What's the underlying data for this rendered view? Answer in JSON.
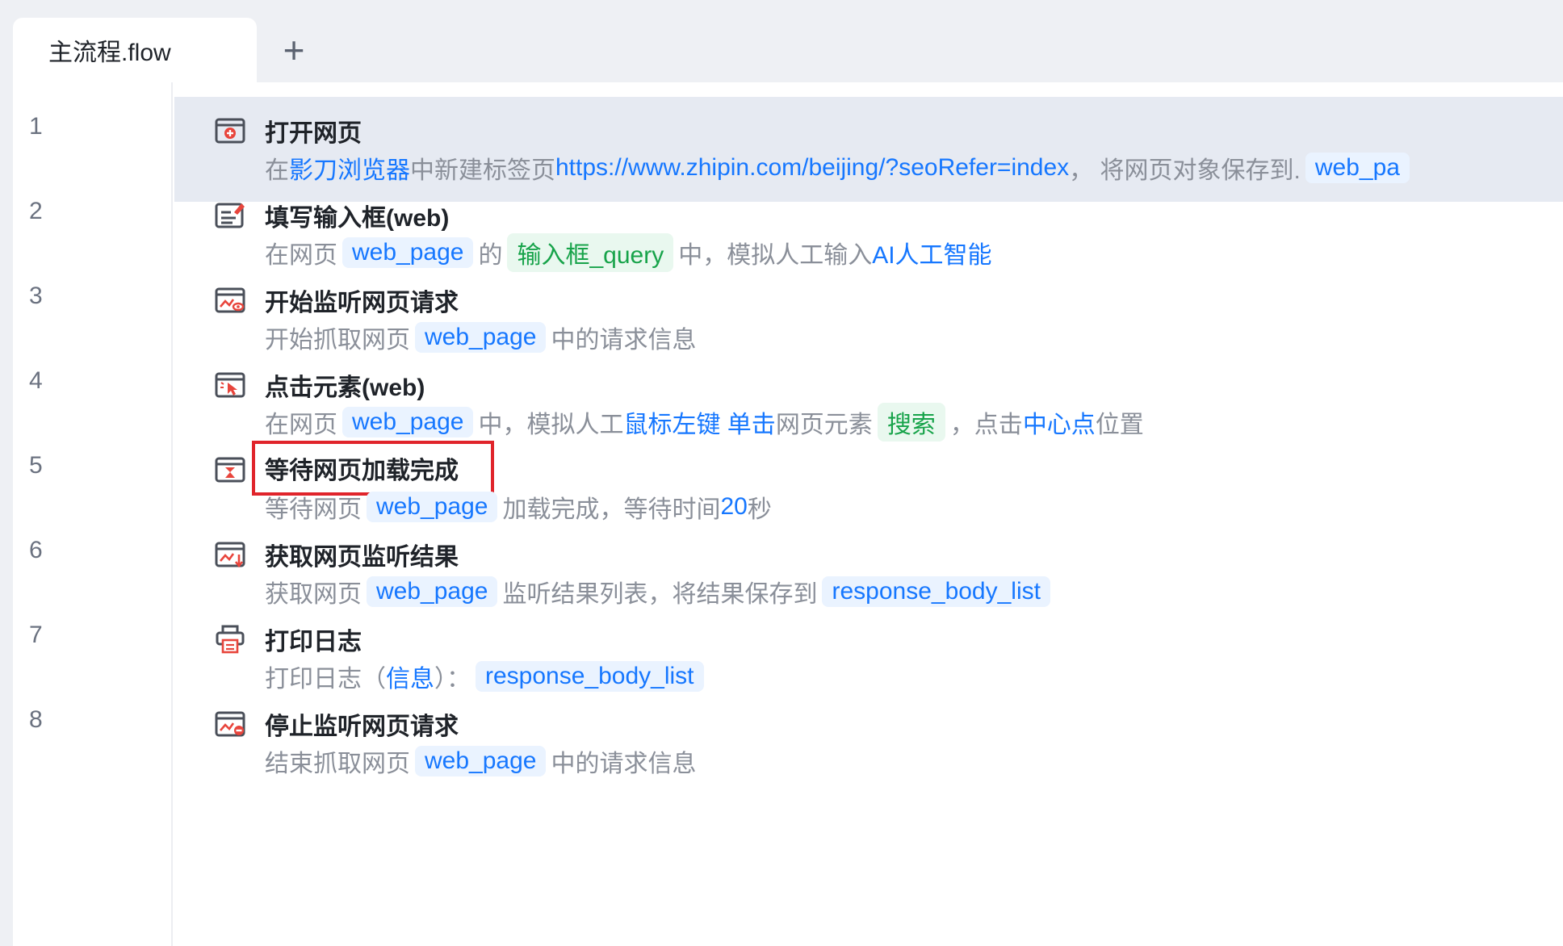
{
  "tabs": [
    {
      "label": "主流程.flow",
      "active": true
    }
  ],
  "add_tab_label": "+",
  "line_numbers": [
    "1",
    "2",
    "3",
    "4",
    "5",
    "6",
    "7",
    "8"
  ],
  "steps": [
    {
      "icon": "open-webpage-icon",
      "title": "打开网页",
      "selected": true,
      "parts": [
        {
          "kind": "text",
          "value": "在 "
        },
        {
          "kind": "link",
          "value": "影刀浏览器"
        },
        {
          "kind": "text",
          "value": " 中新建标签页 "
        },
        {
          "kind": "link",
          "value": "https://www.zhipin.com/beijing/?seoRefer=index"
        },
        {
          "kind": "text",
          "value": " ， 将网页对象保存到."
        },
        {
          "kind": "var",
          "value": "web_pa"
        }
      ]
    },
    {
      "icon": "fill-input-icon",
      "title": "填写输入框(web)",
      "parts": [
        {
          "kind": "text",
          "value": "在网页"
        },
        {
          "kind": "var",
          "value": "web_page"
        },
        {
          "kind": "text",
          "value": "的"
        },
        {
          "kind": "elem",
          "value": "输入框_query"
        },
        {
          "kind": "text",
          "value": "中，模拟人工输入 "
        },
        {
          "kind": "link",
          "value": "AI人工智能"
        }
      ]
    },
    {
      "icon": "start-listen-icon",
      "title": "开始监听网页请求",
      "parts": [
        {
          "kind": "text",
          "value": "开始抓取网页"
        },
        {
          "kind": "var",
          "value": "web_page"
        },
        {
          "kind": "text",
          "value": "中的请求信息"
        }
      ]
    },
    {
      "icon": "click-element-icon",
      "title": "点击元素(web)",
      "parts": [
        {
          "kind": "text",
          "value": "在网页"
        },
        {
          "kind": "var",
          "value": "web_page"
        },
        {
          "kind": "text",
          "value": "中，模拟人工 "
        },
        {
          "kind": "link",
          "value": "鼠标左键 单击"
        },
        {
          "kind": "text",
          "value": " 网页元素"
        },
        {
          "kind": "elem",
          "value": "搜索"
        },
        {
          "kind": "text",
          "value": "，点击 "
        },
        {
          "kind": "link",
          "value": "中心点"
        },
        {
          "kind": "text",
          "value": " 位置"
        }
      ]
    },
    {
      "icon": "wait-load-icon",
      "title": "等待网页加载完成",
      "highlighted": true,
      "parts": [
        {
          "kind": "text",
          "value": "等待网页"
        },
        {
          "kind": "var",
          "value": "web_page"
        },
        {
          "kind": "text",
          "value": "加载完成，等待时间 "
        },
        {
          "kind": "link",
          "value": "20"
        },
        {
          "kind": "text",
          "value": " 秒"
        }
      ]
    },
    {
      "icon": "get-listen-result-icon",
      "title": "获取网页监听结果",
      "parts": [
        {
          "kind": "text",
          "value": "获取网页"
        },
        {
          "kind": "var",
          "value": "web_page"
        },
        {
          "kind": "text",
          "value": "监听结果列表，将结果保存到"
        },
        {
          "kind": "var",
          "value": "response_body_list"
        }
      ]
    },
    {
      "icon": "print-log-icon",
      "title": "打印日志",
      "parts": [
        {
          "kind": "text",
          "value": "打印日志（ "
        },
        {
          "kind": "link",
          "value": "信息"
        },
        {
          "kind": "text",
          "value": " ）： "
        },
        {
          "kind": "var",
          "value": "response_body_list"
        }
      ]
    },
    {
      "icon": "stop-listen-icon",
      "title": "停止监听网页请求",
      "parts": [
        {
          "kind": "text",
          "value": "结束抓取网页"
        },
        {
          "kind": "var",
          "value": "web_page"
        },
        {
          "kind": "text",
          "value": "中的请求信息"
        }
      ]
    }
  ],
  "colors": {
    "link": "#1677ff",
    "var_bg": "#eaf3ff",
    "elem": "#17a34a",
    "elem_bg": "#e9f8ef",
    "selected_row": "#e6eaf2",
    "highlight_box": "#e0242b",
    "icon_red": "#e8453c"
  }
}
